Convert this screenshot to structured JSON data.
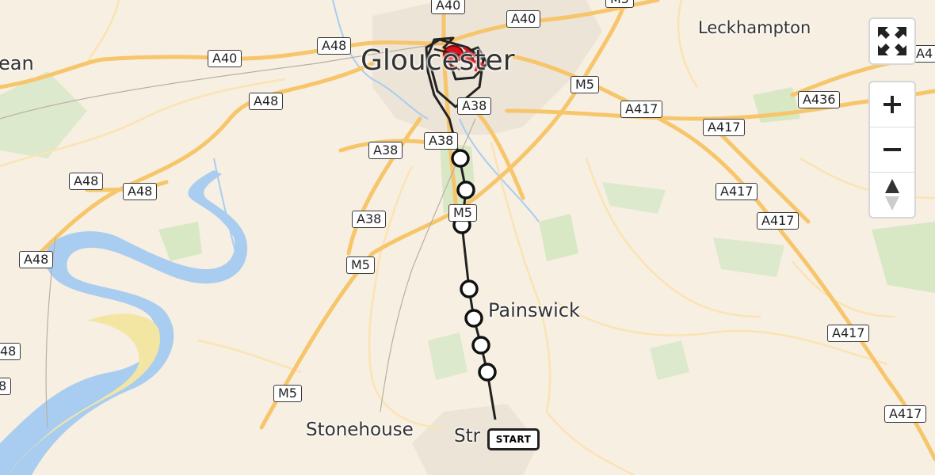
{
  "map": {
    "places": [
      {
        "key": "gloucester",
        "name": "Gloucester"
      },
      {
        "key": "leckhampton",
        "name": "Leckhampton"
      },
      {
        "key": "painswick",
        "name": "Painswick"
      },
      {
        "key": "stonehouse",
        "name": "Stonehouse"
      },
      {
        "key": "stroud",
        "name": "Str"
      },
      {
        "key": "dean",
        "name": "ean"
      }
    ],
    "road_labels": [
      "A40",
      "M5",
      "A40",
      "A40",
      "A48",
      "A48",
      "A38",
      "M5",
      "A417",
      "A436",
      "A417",
      "A38",
      "A38",
      "A48",
      "A48",
      "A417",
      "M5",
      "A417",
      "A38",
      "A48",
      "M5",
      "A417",
      "48",
      "8",
      "M5",
      "A417",
      "A4"
    ],
    "route": {
      "start_label": "START",
      "route_color": "#222222",
      "marker_color": "#e0101a"
    }
  },
  "controls": {
    "fullscreen_icon": "fullscreen-icon",
    "zoom_in_icon": "plus-icon",
    "zoom_out_icon": "minus-icon",
    "compass_icon": "compass-icon"
  },
  "colors": {
    "land": "#f7efe1",
    "water": "#a9cdf0",
    "forest": "#d8e8c5",
    "sand": "#f3e6a3",
    "road": "#f7c56a",
    "urban": "#e8e2d8"
  }
}
